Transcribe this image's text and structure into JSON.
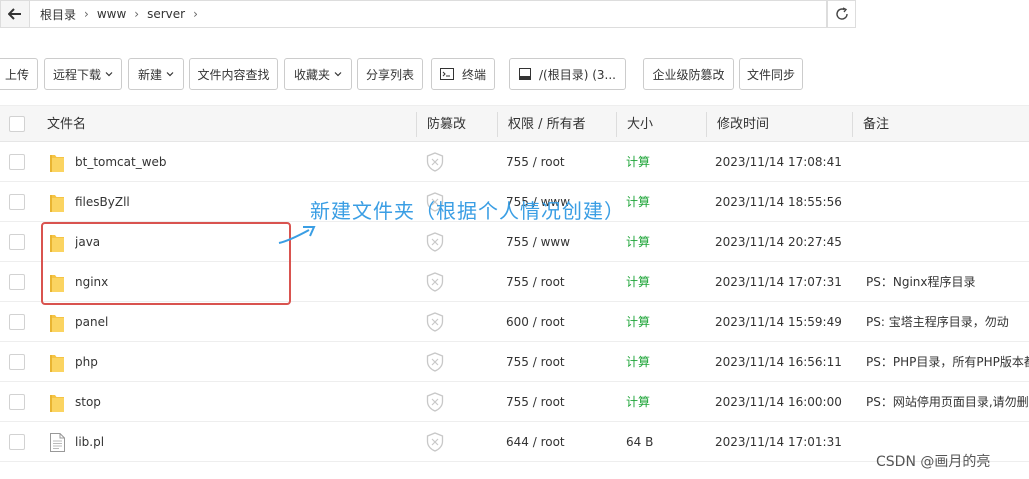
{
  "breadcrumb": {
    "items": [
      "根目录",
      "www",
      "server"
    ]
  },
  "toolbar": {
    "upload": "上传",
    "remote_download": "远程下载",
    "new": "新建",
    "content_search": "文件内容查找",
    "favorites": "收藏夹",
    "share_list": "分享列表",
    "terminal": "终端",
    "disk": "/(根目录) (3...",
    "tamper_proof": "企业级防篡改",
    "file_sync": "文件同步"
  },
  "table": {
    "headers": {
      "name": "文件名",
      "tamper": "防篡改",
      "perm": "权限 / 所有者",
      "size": "大小",
      "mtime": "修改时间",
      "note": "备注"
    },
    "rows": [
      {
        "type": "folder",
        "name": "bt_tomcat_web",
        "perm": "755 / root",
        "size": "计算",
        "mtime": "2023/11/14 17:08:41",
        "note": ""
      },
      {
        "type": "folder",
        "name": "filesByZll",
        "perm": "755 / www",
        "size": "计算",
        "mtime": "2023/11/14 18:55:56",
        "note": ""
      },
      {
        "type": "folder",
        "name": "java",
        "perm": "755 / www",
        "size": "计算",
        "mtime": "2023/11/14 20:27:45",
        "note": ""
      },
      {
        "type": "folder",
        "name": "nginx",
        "perm": "755 / root",
        "size": "计算",
        "mtime": "2023/11/14 17:07:31",
        "note": "PS：Nginx程序目录"
      },
      {
        "type": "folder",
        "name": "panel",
        "perm": "600 / root",
        "size": "计算",
        "mtime": "2023/11/14 15:59:49",
        "note": "PS: 宝塔主程序目录，勿动"
      },
      {
        "type": "folder",
        "name": "php",
        "perm": "755 / root",
        "size": "计算",
        "mtime": "2023/11/14 16:56:11",
        "note": "PS：PHP目录，所有PHP版本都"
      },
      {
        "type": "folder",
        "name": "stop",
        "perm": "755 / root",
        "size": "计算",
        "mtime": "2023/11/14 16:00:00",
        "note": "PS：网站停用页面目录,请勿删"
      },
      {
        "type": "file",
        "name": "lib.pl",
        "perm": "644 / root",
        "size": "64 B",
        "mtime": "2023/11/14 17:01:31",
        "note": ""
      }
    ]
  },
  "annotation": {
    "text": "新建文件夹（根据个人情况创建）"
  },
  "watermark": "CSDN @画月的亮",
  "colors": {
    "accent_green": "#20a53a",
    "annotation_blue": "#3a9ee4",
    "annotation_red": "#d9534f"
  }
}
